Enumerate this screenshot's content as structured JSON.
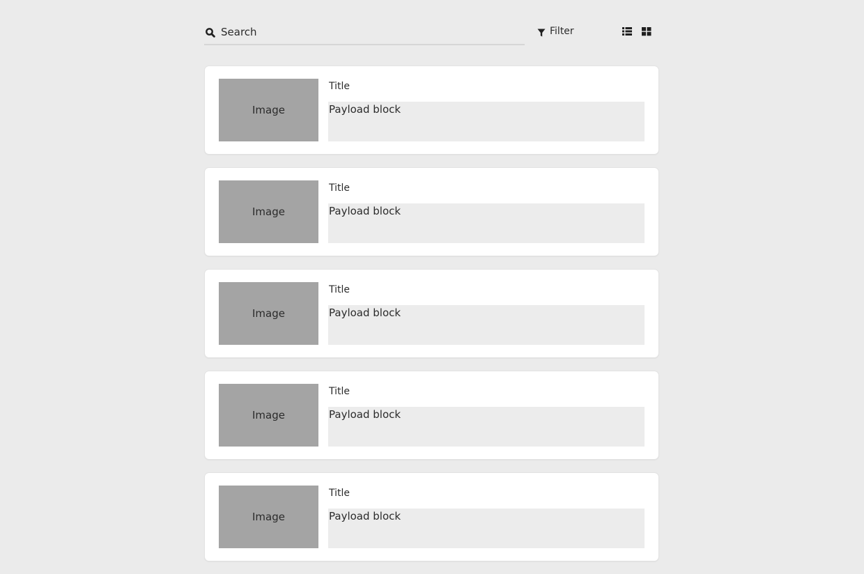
{
  "toolbar": {
    "search_label": "Search",
    "filter_label": "Filter",
    "list_view_icon": "list-view-icon",
    "grid_view_icon": "grid-view-icon",
    "search_icon": "search-icon",
    "filter_icon": "filter-icon"
  },
  "cards": [
    {
      "image_label": "Image",
      "title": "Title",
      "payload": "Payload block"
    },
    {
      "image_label": "Image",
      "title": "Title",
      "payload": "Payload block"
    },
    {
      "image_label": "Image",
      "title": "Title",
      "payload": "Payload block"
    },
    {
      "image_label": "Image",
      "title": "Title",
      "payload": "Payload block"
    },
    {
      "image_label": "Image",
      "title": "Title",
      "payload": "Payload block"
    }
  ],
  "colors": {
    "background": "#ebebeb",
    "card": "#ffffff",
    "image_placeholder": "#a4a4a4",
    "payload_block": "#ececec",
    "text": "#2b2b2b"
  }
}
